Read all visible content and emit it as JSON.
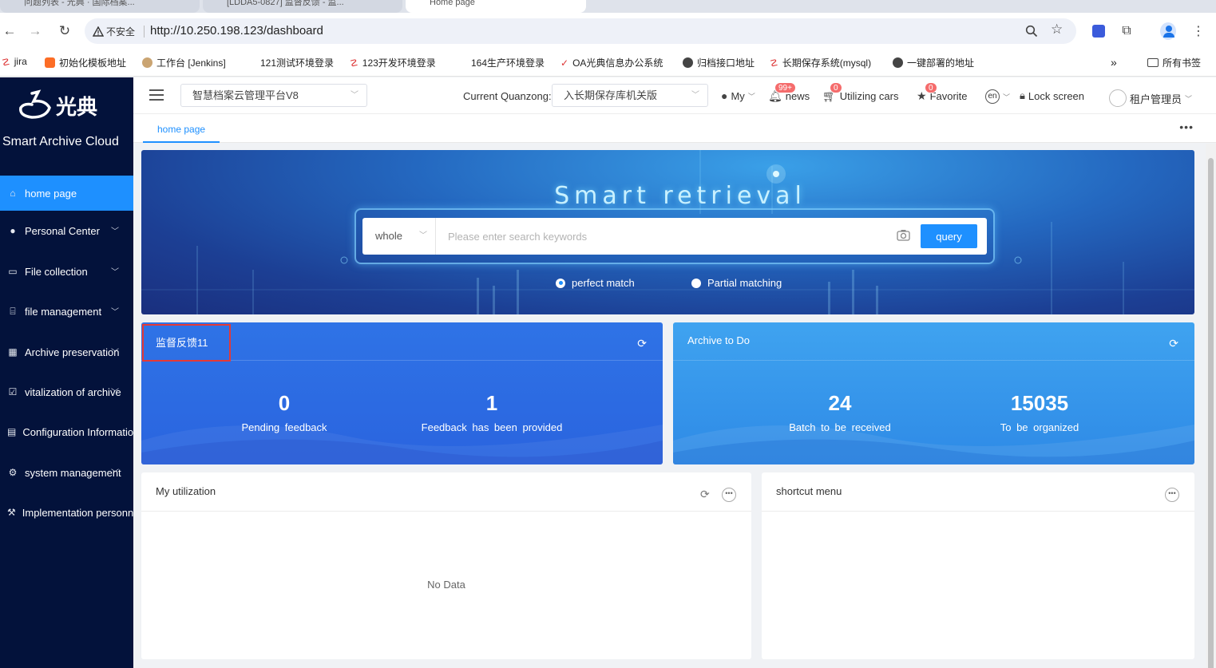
{
  "browser": {
    "tabs": [
      {
        "label": "问题列表 - 光典 · 国际档案..."
      },
      {
        "label": "[LDDA5-0827] 监督反馈 - 监..."
      },
      {
        "label": "Home page"
      }
    ],
    "security_label": "不安全",
    "url": "http://10.250.198.123/dashboard",
    "bookmarks": [
      {
        "label": "jira"
      },
      {
        "label": "初始化模板地址"
      },
      {
        "label": "工作台 [Jenkins]"
      },
      {
        "label": "121测试环境登录"
      },
      {
        "label": "123开发环境登录"
      },
      {
        "label": "164生产环境登录"
      },
      {
        "label": "OA光典信息办公系统"
      },
      {
        "label": "归档接口地址"
      },
      {
        "label": "长期保存系统(mysql)"
      },
      {
        "label": "一键部署的地址"
      }
    ],
    "more_bookmarks": "»",
    "all_bookmarks": "所有书签"
  },
  "sidebar": {
    "brand": "Smart Archive Cloud",
    "logo_text": "光典",
    "items": [
      {
        "label": "home page",
        "icon": "home-icon",
        "active": true
      },
      {
        "label": "Personal Center",
        "icon": "user-icon",
        "has_children": true
      },
      {
        "label": "File collection",
        "icon": "folder-icon",
        "has_children": true
      },
      {
        "label": "file management",
        "icon": "bank-icon",
        "has_children": true
      },
      {
        "label": "Archive preservation",
        "icon": "building-icon",
        "has_children": true
      },
      {
        "label": "vitalization of archive",
        "icon": "check-square-icon",
        "has_children": true
      },
      {
        "label": "Configuration Information",
        "icon": "clipboard-icon",
        "has_children": true
      },
      {
        "label": "system management",
        "icon": "gear-icon",
        "has_children": true
      },
      {
        "label": "Implementation personnel",
        "icon": "wrench-icon",
        "has_children": true
      }
    ]
  },
  "header": {
    "platform_select": "智慧档案云管理平台V8",
    "quanzong_label": "Current Quanzong:",
    "quanzong_select": "入长期保存库机关版",
    "my_label": "My",
    "news_label": "news",
    "news_badge": "99+",
    "cars_label": "Utilizing cars",
    "cars_badge": "0",
    "favorite_label": "Favorite",
    "favorite_badge": "0",
    "lang_label": "en",
    "lock_label": "Lock screen",
    "user_label": "租户管理员"
  },
  "tags": {
    "home": "home page",
    "more": "•••"
  },
  "search": {
    "title": "Smart retrieval",
    "scope": "whole",
    "placeholder": "Please enter search keywords",
    "button": "query",
    "options": [
      {
        "label": "perfect match",
        "selected": true
      },
      {
        "label": "Partial matching",
        "selected": false
      }
    ]
  },
  "cards": {
    "feedback": {
      "title": "监督反馈11",
      "stats": [
        {
          "value": "0",
          "label": "Pending feedback"
        },
        {
          "value": "1",
          "label": "Feedback has been provided"
        }
      ]
    },
    "archive": {
      "title": "Archive to Do",
      "stats": [
        {
          "value": "24",
          "label": "Batch to be received"
        },
        {
          "value": "15035",
          "label": "To be organized"
        }
      ]
    }
  },
  "panels": {
    "utilization": {
      "title": "My utilization",
      "empty": "No Data"
    },
    "shortcut": {
      "title": "shortcut menu"
    }
  },
  "colors": {
    "primary": "#1e90ff",
    "sidebar_bg": "#03123b",
    "badge": "#f56c6c",
    "highlight": "#e53935"
  }
}
